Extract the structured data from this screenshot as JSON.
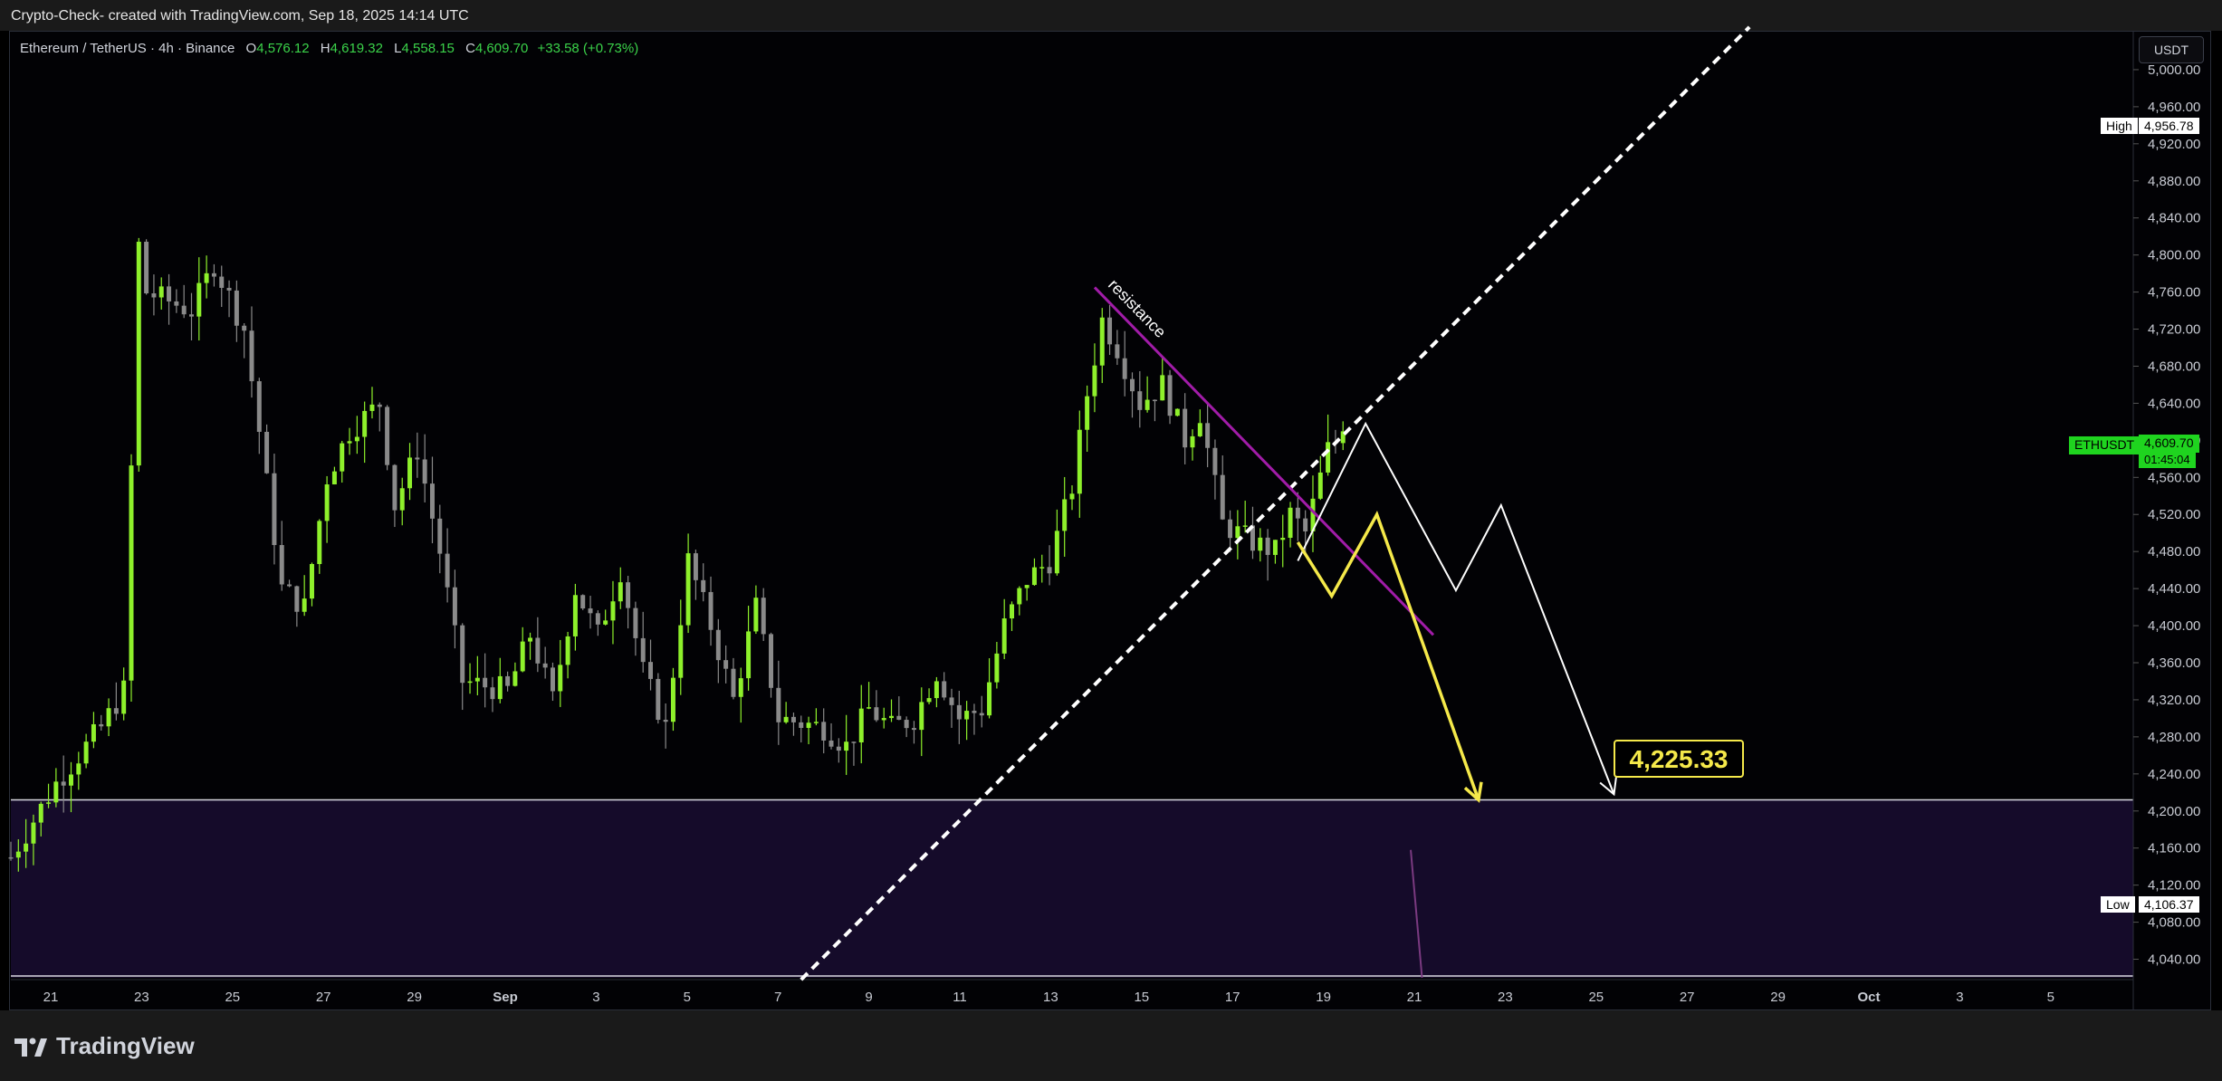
{
  "header": {
    "attribution": "Crypto-Check- created with TradingView.com, Sep 18, 2025 14:14 UTC"
  },
  "legend": {
    "symbol": "Ethereum / TetherUS · 4h · Binance",
    "o_label": "O",
    "o_value": "4,576.12",
    "h_label": "H",
    "h_value": "4,619.32",
    "l_label": "L",
    "l_value": "4,558.15",
    "c_label": "C",
    "c_value": "4,609.70",
    "change": "+33.58 (+0.73%)"
  },
  "currency_button": "USDT",
  "price_scale": {
    "ticks": [
      "5,000.00",
      "4,960.00",
      "4,920.00",
      "4,880.00",
      "4,840.00",
      "4,800.00",
      "4,760.00",
      "4,720.00",
      "4,680.00",
      "4,640.00",
      "4,600.00",
      "4,560.00",
      "4,520.00",
      "4,480.00",
      "4,440.00",
      "4,400.00",
      "4,360.00",
      "4,320.00",
      "4,280.00",
      "4,240.00",
      "4,200.00",
      "4,160.00",
      "4,120.00",
      "4,080.00",
      "4,040.00"
    ],
    "high_label": "High",
    "high_value": "4,956.78",
    "low_label": "Low",
    "low_value": "4,106.37",
    "current_symbol": "ETHUSDT",
    "current_value": "4,609.70",
    "countdown": "01:45:04"
  },
  "time_axis": {
    "labels": [
      "21",
      "23",
      "25",
      "27",
      "29",
      "Sep",
      "3",
      "5",
      "7",
      "9",
      "11",
      "13",
      "15",
      "17",
      "19",
      "21",
      "23",
      "25",
      "27",
      "29",
      "Oct",
      "3",
      "5"
    ]
  },
  "annotations": {
    "resistance_label": "resistance",
    "target_value": "4,225.33"
  },
  "colors": {
    "bull": "#8ef02b",
    "bear": "#8a8a8a",
    "resistance": "#a11ca8",
    "zone": "#150b2a",
    "projection_yellow": "#f5e94a",
    "projection_white": "#ffffff",
    "current_badge": "#1fd41f"
  },
  "footer": {
    "brand": "TradingView"
  },
  "chart_data": {
    "type": "candlestick",
    "symbol": "ETHUSDT",
    "interval": "4h",
    "ylim": [
      4020,
      5040
    ],
    "x_range": [
      "Aug 20",
      "Oct 6"
    ],
    "support_zone": [
      4020,
      4212
    ],
    "current_price": 4609.7,
    "high": 4956.78,
    "low": 4106.37,
    "target": 4225.33,
    "resistance_line": [
      [
        "Sep 13 00:00",
        4765
      ],
      [
        "Sep 20 12:00",
        4390
      ]
    ],
    "trend_line": [
      [
        "Sep 6 12:00",
        4018
      ],
      [
        "Sep 27 12:00",
        5046
      ]
    ],
    "yellow_path": [
      [
        "Sep 17 12:00",
        4490
      ],
      [
        "Sep 18 06:00",
        4432
      ],
      [
        "Sep 19 06:00",
        4520
      ],
      [
        "Sep 21 12:00",
        4212
      ]
    ],
    "white_path": [
      [
        "Sep 17 12:00",
        4470
      ],
      [
        "Sep 19 00:00",
        4618
      ],
      [
        "Sep 21 00:00",
        4438
      ],
      [
        "Sep 22 00:00",
        4530
      ],
      [
        "Sep 24 12:00",
        4218
      ]
    ],
    "purple_tick": [
      [
        "Sep 20 00:00",
        4158
      ],
      [
        "Sep 20 06:00",
        4020
      ]
    ],
    "anchor_points": [
      [
        "Aug 20",
        4150
      ],
      [
        "Aug 21",
        4230
      ],
      [
        "Aug 22",
        4290
      ],
      [
        "Aug 22 12:00",
        4330
      ],
      [
        "Aug 22 20:00",
        4810
      ],
      [
        "Aug 23",
        4760
      ],
      [
        "Aug 24",
        4740
      ],
      [
        "Aug 24 12:00",
        4790
      ],
      [
        "Aug 25 04:00",
        4720
      ],
      [
        "Aug 25 12:00",
        4610
      ],
      [
        "Aug 26",
        4440
      ],
      [
        "Aug 26 12:00",
        4420
      ],
      [
        "Aug 27",
        4560
      ],
      [
        "Aug 27 12:00",
        4610
      ],
      [
        "Aug 28 04:00",
        4640
      ],
      [
        "Aug 28 12:00",
        4530
      ],
      [
        "Aug 29",
        4590
      ],
      [
        "Aug 29 12:00",
        4480
      ],
      [
        "Aug 30",
        4340
      ],
      [
        "Aug 31",
        4330
      ],
      [
        "Aug 31 12:00",
        4390
      ],
      [
        "Sep 1",
        4320
      ],
      [
        "Sep 1 12:00",
        4440
      ],
      [
        "Sep 2",
        4390
      ],
      [
        "Sep 2 12:00",
        4460
      ],
      [
        "Sep 3",
        4350
      ],
      [
        "Sep 3 12:00",
        4290
      ],
      [
        "Sep 4",
        4470
      ],
      [
        "Sep 4 12:00",
        4400
      ],
      [
        "Sep 5",
        4320
      ],
      [
        "Sep 5 12:00",
        4420
      ],
      [
        "Sep 6",
        4300
      ],
      [
        "Sep 7",
        4290
      ],
      [
        "Sep 7 12:00",
        4270
      ],
      [
        "Sep 8",
        4310
      ],
      [
        "Sep 8 12:00",
        4290
      ],
      [
        "Sep 9",
        4300
      ],
      [
        "Sep 9 12:00",
        4350
      ],
      [
        "Sep 10",
        4300
      ],
      [
        "Sep 10 12:00",
        4310
      ],
      [
        "Sep 11",
        4400
      ],
      [
        "Sep 11 12:00",
        4450
      ],
      [
        "Sep 12",
        4470
      ],
      [
        "Sep 12 12:00",
        4550
      ],
      [
        "Sep 12 20:00",
        4650
      ],
      [
        "Sep 13 04:00",
        4730
      ],
      [
        "Sep 13 12:00",
        4700
      ],
      [
        "Sep 14",
        4640
      ],
      [
        "Sep 14 12:00",
        4660
      ],
      [
        "Sep 15",
        4600
      ],
      [
        "Sep 15 08:00",
        4630
      ],
      [
        "Sep 15 20:00",
        4510
      ],
      [
        "Sep 16 04:00",
        4500
      ],
      [
        "Sep 16 12:00",
        4490
      ],
      [
        "Sep 17",
        4480
      ],
      [
        "Sep 17 08:00",
        4520
      ],
      [
        "Sep 17 16:00",
        4500
      ],
      [
        "Sep 18 04:00",
        4590
      ],
      [
        "Sep 18 14:00",
        4609.7
      ]
    ]
  }
}
